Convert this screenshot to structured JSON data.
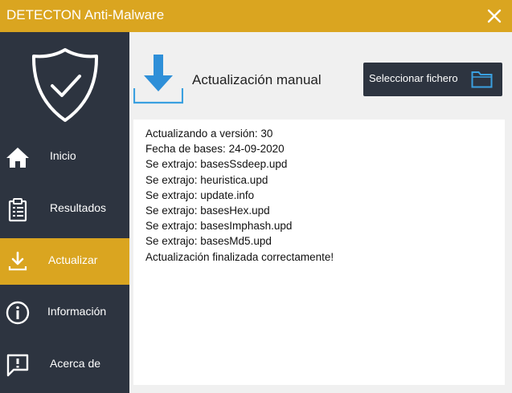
{
  "window": {
    "title": "DETECTON Anti-Malware",
    "close_icon": "close-icon"
  },
  "colors": {
    "accent": "#daa520",
    "sidebar": "#2d3440",
    "button_dark": "#2d3440",
    "folder_blue": "#3aa0e0",
    "download_blue": "#2e8fd8"
  },
  "sidebar": {
    "logo_icon": "shield-check-icon",
    "items": [
      {
        "label": "Inicio",
        "icon": "home-icon",
        "active": false
      },
      {
        "label": "Resultados",
        "icon": "clipboard-icon",
        "active": false
      },
      {
        "label": "Actualizar",
        "icon": "download-icon",
        "active": true
      },
      {
        "label": "Información",
        "icon": "info-icon",
        "active": false
      },
      {
        "label": "Acerca de",
        "icon": "chat-alert-icon",
        "active": false
      }
    ]
  },
  "main": {
    "icon": "download-icon",
    "heading": "Actualización manual",
    "select_button": {
      "label": "Seleccionar fichero",
      "icon": "folder-icon"
    },
    "log_lines": [
      "Actualizando a versión: 30",
      "Fecha de bases: 24-09-2020",
      "Se extrajo: basesSsdeep.upd",
      "Se extrajo: heuristica.upd",
      "Se extrajo: update.info",
      "Se extrajo: basesHex.upd",
      "Se extrajo: basesImphash.upd",
      "Se extrajo: basesMd5.upd",
      "Actualización finalizada correctamente!"
    ]
  }
}
